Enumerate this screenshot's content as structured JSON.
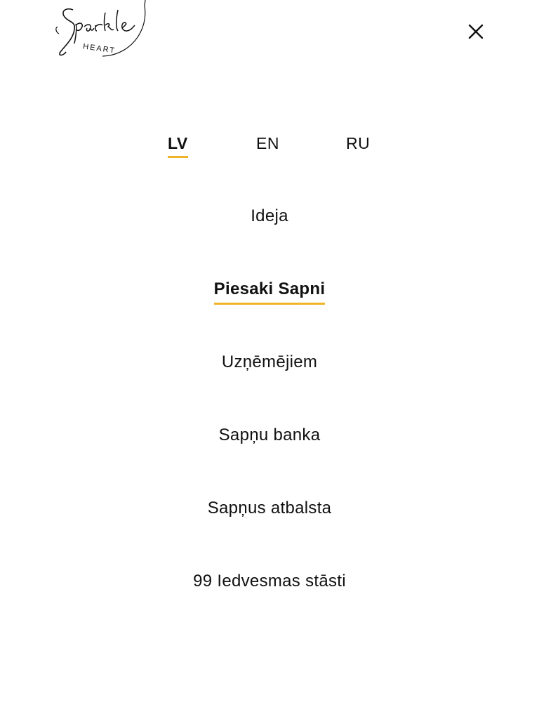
{
  "header": {
    "logo": {
      "text": "Sparkle",
      "subtext": "HEART",
      "icon": "sparkle-heart-logo"
    },
    "close_icon": "close-icon"
  },
  "languages": [
    {
      "label": "LV",
      "active": true
    },
    {
      "label": "EN",
      "active": false
    },
    {
      "label": "RU",
      "active": false
    }
  ],
  "menu": {
    "items": [
      {
        "label": "Ideja",
        "active": false
      },
      {
        "label": "Piesaki Sapni",
        "active": true
      },
      {
        "label": "Uzņēmējiem",
        "active": false
      },
      {
        "label": "Sapņu banka",
        "active": false
      },
      {
        "label": "Sapņus atbalsta",
        "active": false
      },
      {
        "label": "99 Iedvesmas stāsti",
        "active": false
      }
    ]
  },
  "colors": {
    "accent": "#f0b429",
    "text": "#111111",
    "background": "#ffffff"
  }
}
